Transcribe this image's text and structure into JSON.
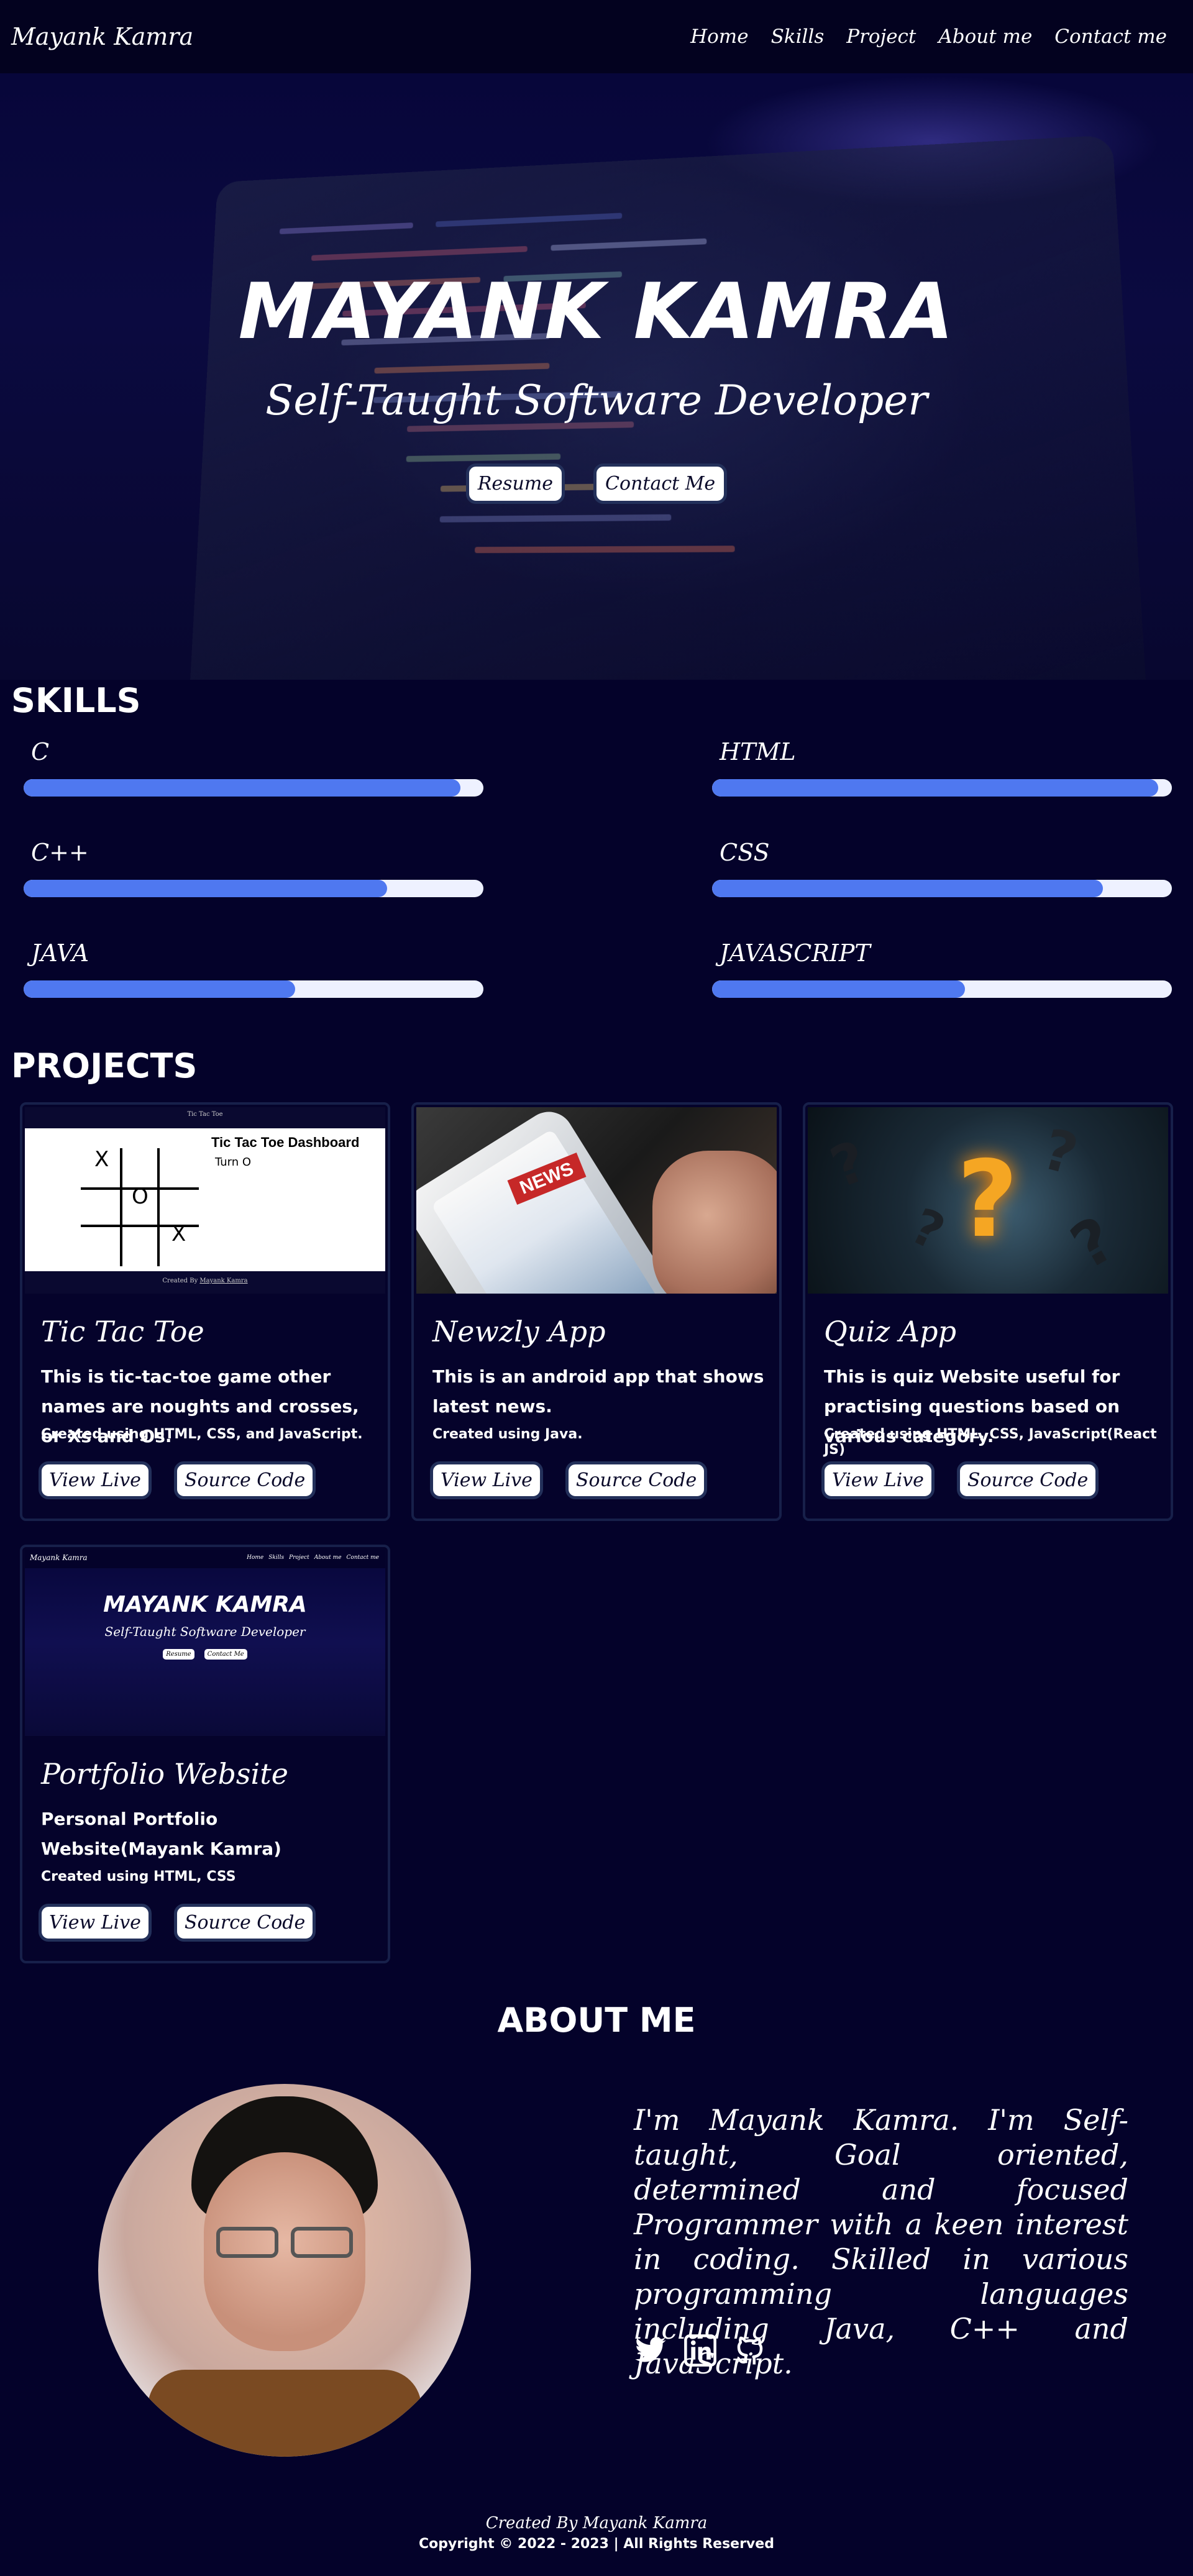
{
  "nav": {
    "brand": "Mayank Kamra",
    "links": [
      "Home",
      "Skills",
      "Project",
      "About me",
      "Contact me"
    ]
  },
  "hero": {
    "title": "MAYANK KAMRA",
    "subtitle": "Self-Taught Software Developer",
    "resume_label": "Resume",
    "contact_label": "Contact Me"
  },
  "skills": {
    "heading": "SKILLS",
    "items": [
      {
        "name": "C",
        "level": 0.95
      },
      {
        "name": "HTML",
        "level": 0.97
      },
      {
        "name": "C++",
        "level": 0.79
      },
      {
        "name": "CSS",
        "level": 0.85
      },
      {
        "name": "JAVA",
        "level": 0.59
      },
      {
        "name": "JAVASCRIPT",
        "level": 0.55
      }
    ]
  },
  "projects": {
    "heading": "PROJECTS",
    "items": [
      {
        "title": "Tic Tac Toe",
        "description": "This is tic-tac-toe game other names are noughts and crosses, or Xs and Os.",
        "tech": "Created using HTML, CSS, and JavaScript.",
        "live_label": "View Live",
        "source_label": "Source Code",
        "thumb": {
          "top_label": "Tic Tac Toe",
          "dashboard": "Tic Tac Toe Dashboard",
          "turn": "Turn O",
          "footer_prefix": "Created By",
          "footer_name": "Mayank Kamra",
          "cells": [
            "X",
            "",
            "",
            "",
            "O",
            "",
            "",
            "X",
            ""
          ]
        }
      },
      {
        "title": "Newzly App",
        "description": "This is an android app that shows latest news.",
        "tech": "Created using Java.",
        "live_label": "View Live",
        "source_label": "Source Code",
        "thumb": {
          "badge": "NEWS"
        }
      },
      {
        "title": "Quiz App",
        "description": "This is quiz Website useful for practising questions based on various category.",
        "tech": "Created using HTML, CSS, JavaScript(React JS)",
        "live_label": "View Live",
        "source_label": "Source Code",
        "thumb": {
          "glyph": "?"
        }
      },
      {
        "title": "Portfolio Website",
        "description": "Personal Portfolio Website(Mayank Kamra)",
        "tech": "Created using HTML, CSS",
        "live_label": "View Live",
        "source_label": "Source Code",
        "thumb": {
          "brand": "Mayank Kamra",
          "links": [
            "Home",
            "Skills",
            "Project",
            "About me",
            "Contact me"
          ],
          "title": "MAYANK KAMRA",
          "subtitle": "Self-Taught Software Developer",
          "btn1": "Resume",
          "btn2": "Contact Me"
        }
      }
    ]
  },
  "about": {
    "heading": "ABOUT ME",
    "text": "I'm Mayank Kamra. I'm Self-taught, Goal oriented, determined and focused Programmer with a keen interest in coding. Skilled in various programming languages including Java, C++ and JavaScript.",
    "socials": [
      "twitter-icon",
      "linkedin-icon",
      "github-icon"
    ]
  },
  "footer": {
    "created_by": "Created By",
    "author": "Mayank Kamra",
    "copyright": "Copyright © 2022 - 2023 | All Rights Reserved"
  },
  "colors": {
    "background": "#04022a",
    "accent": "#4f78f0",
    "bar_track": "#eef1ff"
  }
}
